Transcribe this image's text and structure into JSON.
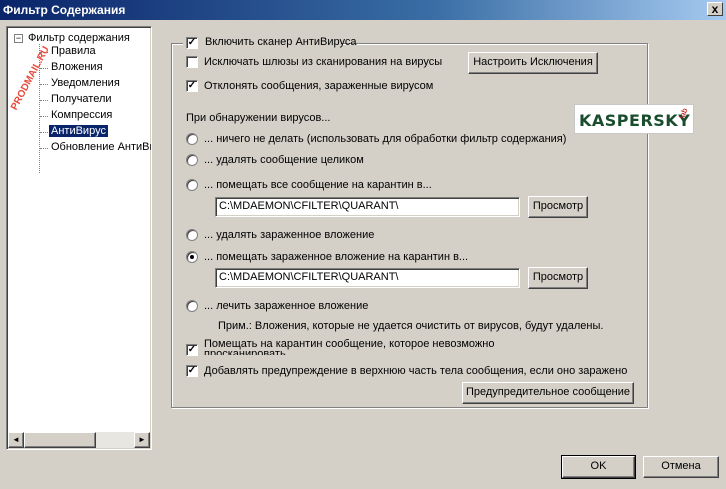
{
  "window": {
    "title": "Фильтр Содержания",
    "close_label": "x"
  },
  "tree": {
    "watermark": "PRODMAIL.RU",
    "toggle": "−",
    "root": "Фильтр содержания",
    "items": [
      {
        "label": "Правила"
      },
      {
        "label": "Вложения"
      },
      {
        "label": "Уведомления"
      },
      {
        "label": "Получатели"
      },
      {
        "label": "Компрессия"
      },
      {
        "label": "АнтиВирус"
      },
      {
        "label": "Обновление АнтиВирус"
      }
    ],
    "selected_index": 5,
    "scroll_left": "◄",
    "scroll_right": "►"
  },
  "antivirus": {
    "enable_label": "Включить сканер АнтиВируса",
    "enable_checked": true,
    "check_mark": "✓",
    "exclude_gateways_label": "Исключать шлюзы из сканирования на вирусы",
    "exclude_gateways_checked": false,
    "configure_exclusions_button": "Настроить Исключения",
    "reject_infected_label": "Отклонять сообщения, зараженные вирусом",
    "reject_infected_checked": true,
    "on_detect_heading": "При обнаружении вирусов...",
    "logo_text": "KASPERSKY",
    "logo_lab": "lab",
    "options": [
      {
        "label": "... ничего не делать (использовать для обработки фильтр содержания)",
        "selected": false
      },
      {
        "label": "... удалять сообщение целиком",
        "selected": false
      },
      {
        "label": "... помещать все сообщение на карантин в...",
        "selected": false
      },
      {
        "label": "... удалять зараженное вложение",
        "selected": false
      },
      {
        "label": "... помещать зараженное вложение на карантин в...",
        "selected": true
      },
      {
        "label": "... лечить зараженное вложение",
        "selected": false
      }
    ],
    "quarantine_message_path": "C:\\MDAEMON\\CFILTER\\QUARANT\\",
    "quarantine_attachment_path": "C:\\MDAEMON\\CFILTER\\QUARANT\\",
    "browse_button": "Просмотр",
    "note": "Прим.: Вложения, которые не удается очистить от вирусов, будут удалены.",
    "quarantine_unscannable_label": "Помещать на карантин сообщение, которое невозможно просканировать",
    "quarantine_unscannable_checked": true,
    "add_warning_label": "Добавлять предупреждение в верхнюю часть тела сообщения, если оно заражено",
    "add_warning_checked": true,
    "warning_message_button": "Предупредительное сообщение"
  },
  "footer": {
    "ok_button": "OK",
    "cancel_button": "Отмена"
  }
}
